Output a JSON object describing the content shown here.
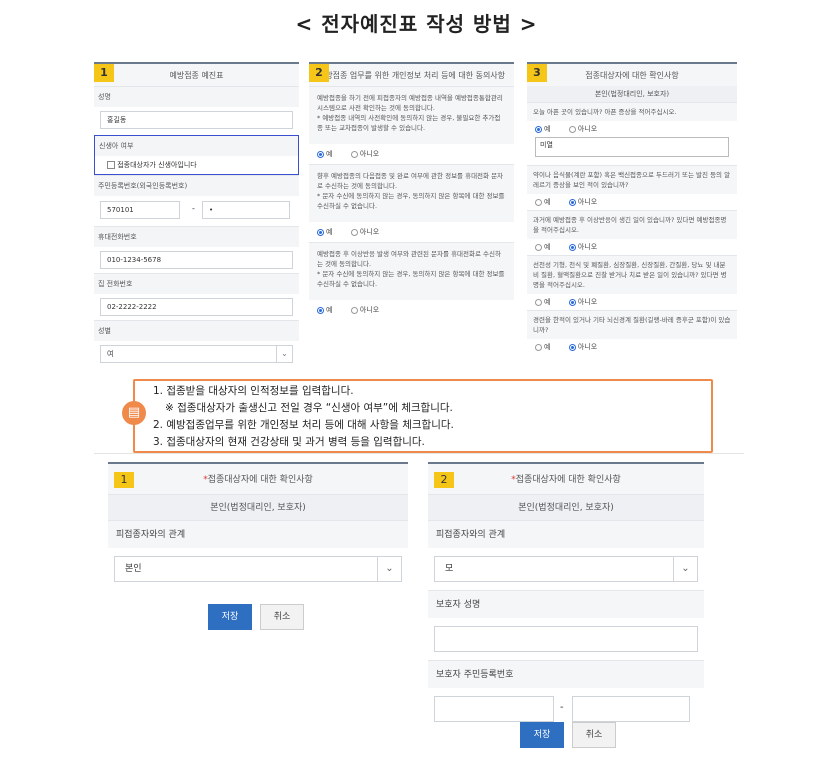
{
  "title": "< 전자예진표 작성 방법 >",
  "panel1": {
    "num": "1",
    "header": "예방접종 예진표",
    "name_label": "성명",
    "name_value": "홍길동",
    "newborn_label": "신생아 여부",
    "newborn_checkbox": "접종대상자가 신생아입니다",
    "rrn_label": "주민등록번호(외국인등록번호)",
    "rrn_front": "570101",
    "rrn_dash": "-",
    "rrn_back": "•",
    "mobile_label": "휴대전화번호",
    "mobile_value": "010-1234-5678",
    "home_label": "집 전화번호",
    "home_value": "02-2222-2222",
    "gender_label": "성별",
    "gender_value": "여",
    "chevron": "⌄"
  },
  "panel2": {
    "num": "2",
    "header": "예방접종 업무를 위한 개인정보 처리 등에 대한 동의사항",
    "block1": "예방접종을 하기 전에 피접종자의 예방접종 내역을 예방접종통합관리시스템으로 사전 확인하는 것에 동의합니다.\n* 예방접종 내역의 사전확인에 동의하지 않는 경우, 불필요한 추가접종 또는 교차접종이 발생할 수 있습니다.",
    "block2": "향후 예방접종의 다음접종 및 완료 여부에 관한 정보를 휴대전화 문자로 수신하는 것에 동의합니다.\n* 문자 수신에 동의하지 않는 경우, 동의하지 않은 항목에 대한 정보를 수신하실 수 없습니다.",
    "block3": "예방접종 후 이상반응 발생 여부와 관련된 문자를 휴대전화로 수신하는 것에 동의합니다.\n* 문자 수신에 동의하지 않는 경우, 동의하지 않은 항목에 대한 정보를 수신하실 수 없습니다.",
    "yes": "예",
    "no": "아니오"
  },
  "panel3": {
    "num": "3",
    "header": "접종대상자에 대한 확인사항",
    "sub": "본인(법정대리인, 보호자)",
    "q1": "오늘 아픈 곳이 있습니까? 아픈 증상을 적어주십시오.",
    "q1_text": "미열",
    "q2": "약이나 음식물(계란 포함) 혹은 백신접종으로 두드러기 또는 발진 등의 알레르기 증상을 보인 적이 있습니까?",
    "q3": "과거에 예방접종 후 이상반응이 생긴 일이 있습니까? 있다면 예방접종명을 적어주십시오.",
    "q4": "선천성 기형, 천식 및 폐질환, 심장질환, 신장질환, 간질환, 당뇨 및 내분비 질환, 혈액질환으로 진찰 받거나 치료 받은 일이 있습니까? 있다면 병명을 적어주십시오.",
    "q5": "경련을 한적이 있거나 기타 뇌신경계 질환(길랭-바레 증후군 포함)이 있습니까?",
    "yes": "예",
    "no": "아니오"
  },
  "note": {
    "line1": "1. 접종받을 대상자의 인적정보를 입력합니다.",
    "line2": "※ 접종대상자가 출생신고 전일 경우 “신생아 여부”에 체크합니다.",
    "line3": "2. 예방접종업무를 위한 개인정보 처리 등에 대해 사항을 체크합니다.",
    "line4": "3. 접종대상자의 현재 건강상태 및 과거 병력 등을 입력합니다.",
    "icon": "▤"
  },
  "bottom1": {
    "num": "1",
    "star": "*",
    "header": "접종대상자에 대한 확인사항",
    "sub": "본인(법정대리인, 보호자)",
    "relation_label": "피접종자와의 관계",
    "relation_value": "본인",
    "save": "저장",
    "cancel": "취소",
    "chevron": "⌄"
  },
  "bottom2": {
    "num": "2",
    "star": "*",
    "header": "접종대상자에 대한 확인사항",
    "sub": "본인(법정대리인, 보호자)",
    "relation_label": "피접종자와의 관계",
    "relation_value": "모",
    "guardian_name_label": "보호자 성명",
    "guardian_rrn_label": "보호자 주민등록번호",
    "dash": "-",
    "save": "저장",
    "cancel": "취소",
    "chevron": "⌄"
  }
}
